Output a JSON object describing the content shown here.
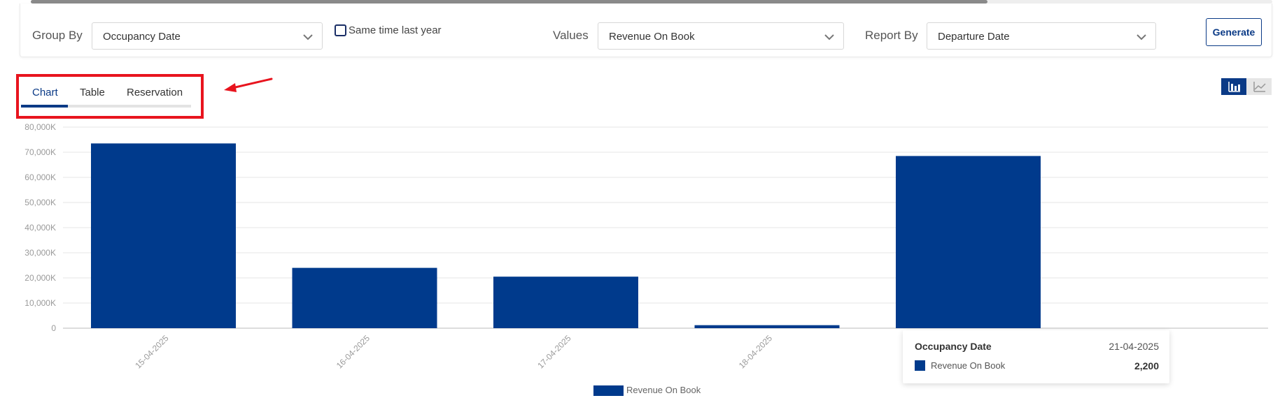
{
  "filters": {
    "group_by_label": "Group By",
    "group_by_value": "Occupancy Date",
    "same_time_last_year_label": "Same time last year",
    "values_label": "Values",
    "values_value": "Revenue On Book",
    "report_by_label": "Report By",
    "report_by_value": "Departure Date",
    "generate_label": "Generate"
  },
  "tabs": [
    {
      "label": "Chart",
      "active": true
    },
    {
      "label": "Table",
      "active": false
    },
    {
      "label": "Reservation",
      "active": false
    }
  ],
  "view_toggle": {
    "active": "bar-chart-icon",
    "inactive": "line-chart-icon"
  },
  "colors": {
    "accent": "#003a8c",
    "highlight_box": "#e8141e"
  },
  "chart_data": {
    "type": "bar",
    "categories": [
      "15-04-2025",
      "16-04-2025",
      "17-04-2025",
      "18-04-2025",
      "21-04-2025"
    ],
    "series": [
      {
        "name": "Revenue On Book",
        "values": [
          73500,
          24000,
          20500,
          1200,
          68500
        ]
      }
    ],
    "ylim": [
      0,
      80000
    ],
    "y_ticks": [
      "0",
      "10,000K",
      "20,000K",
      "30,000K",
      "40,000K",
      "50,000K",
      "60,000K",
      "70,000K",
      "80,000K"
    ],
    "grid": true,
    "legend_position": "bottom-center"
  },
  "tooltip": {
    "title": "Occupancy Date",
    "date": "21-04-2025",
    "series": "Revenue On Book",
    "value": "2,200"
  }
}
